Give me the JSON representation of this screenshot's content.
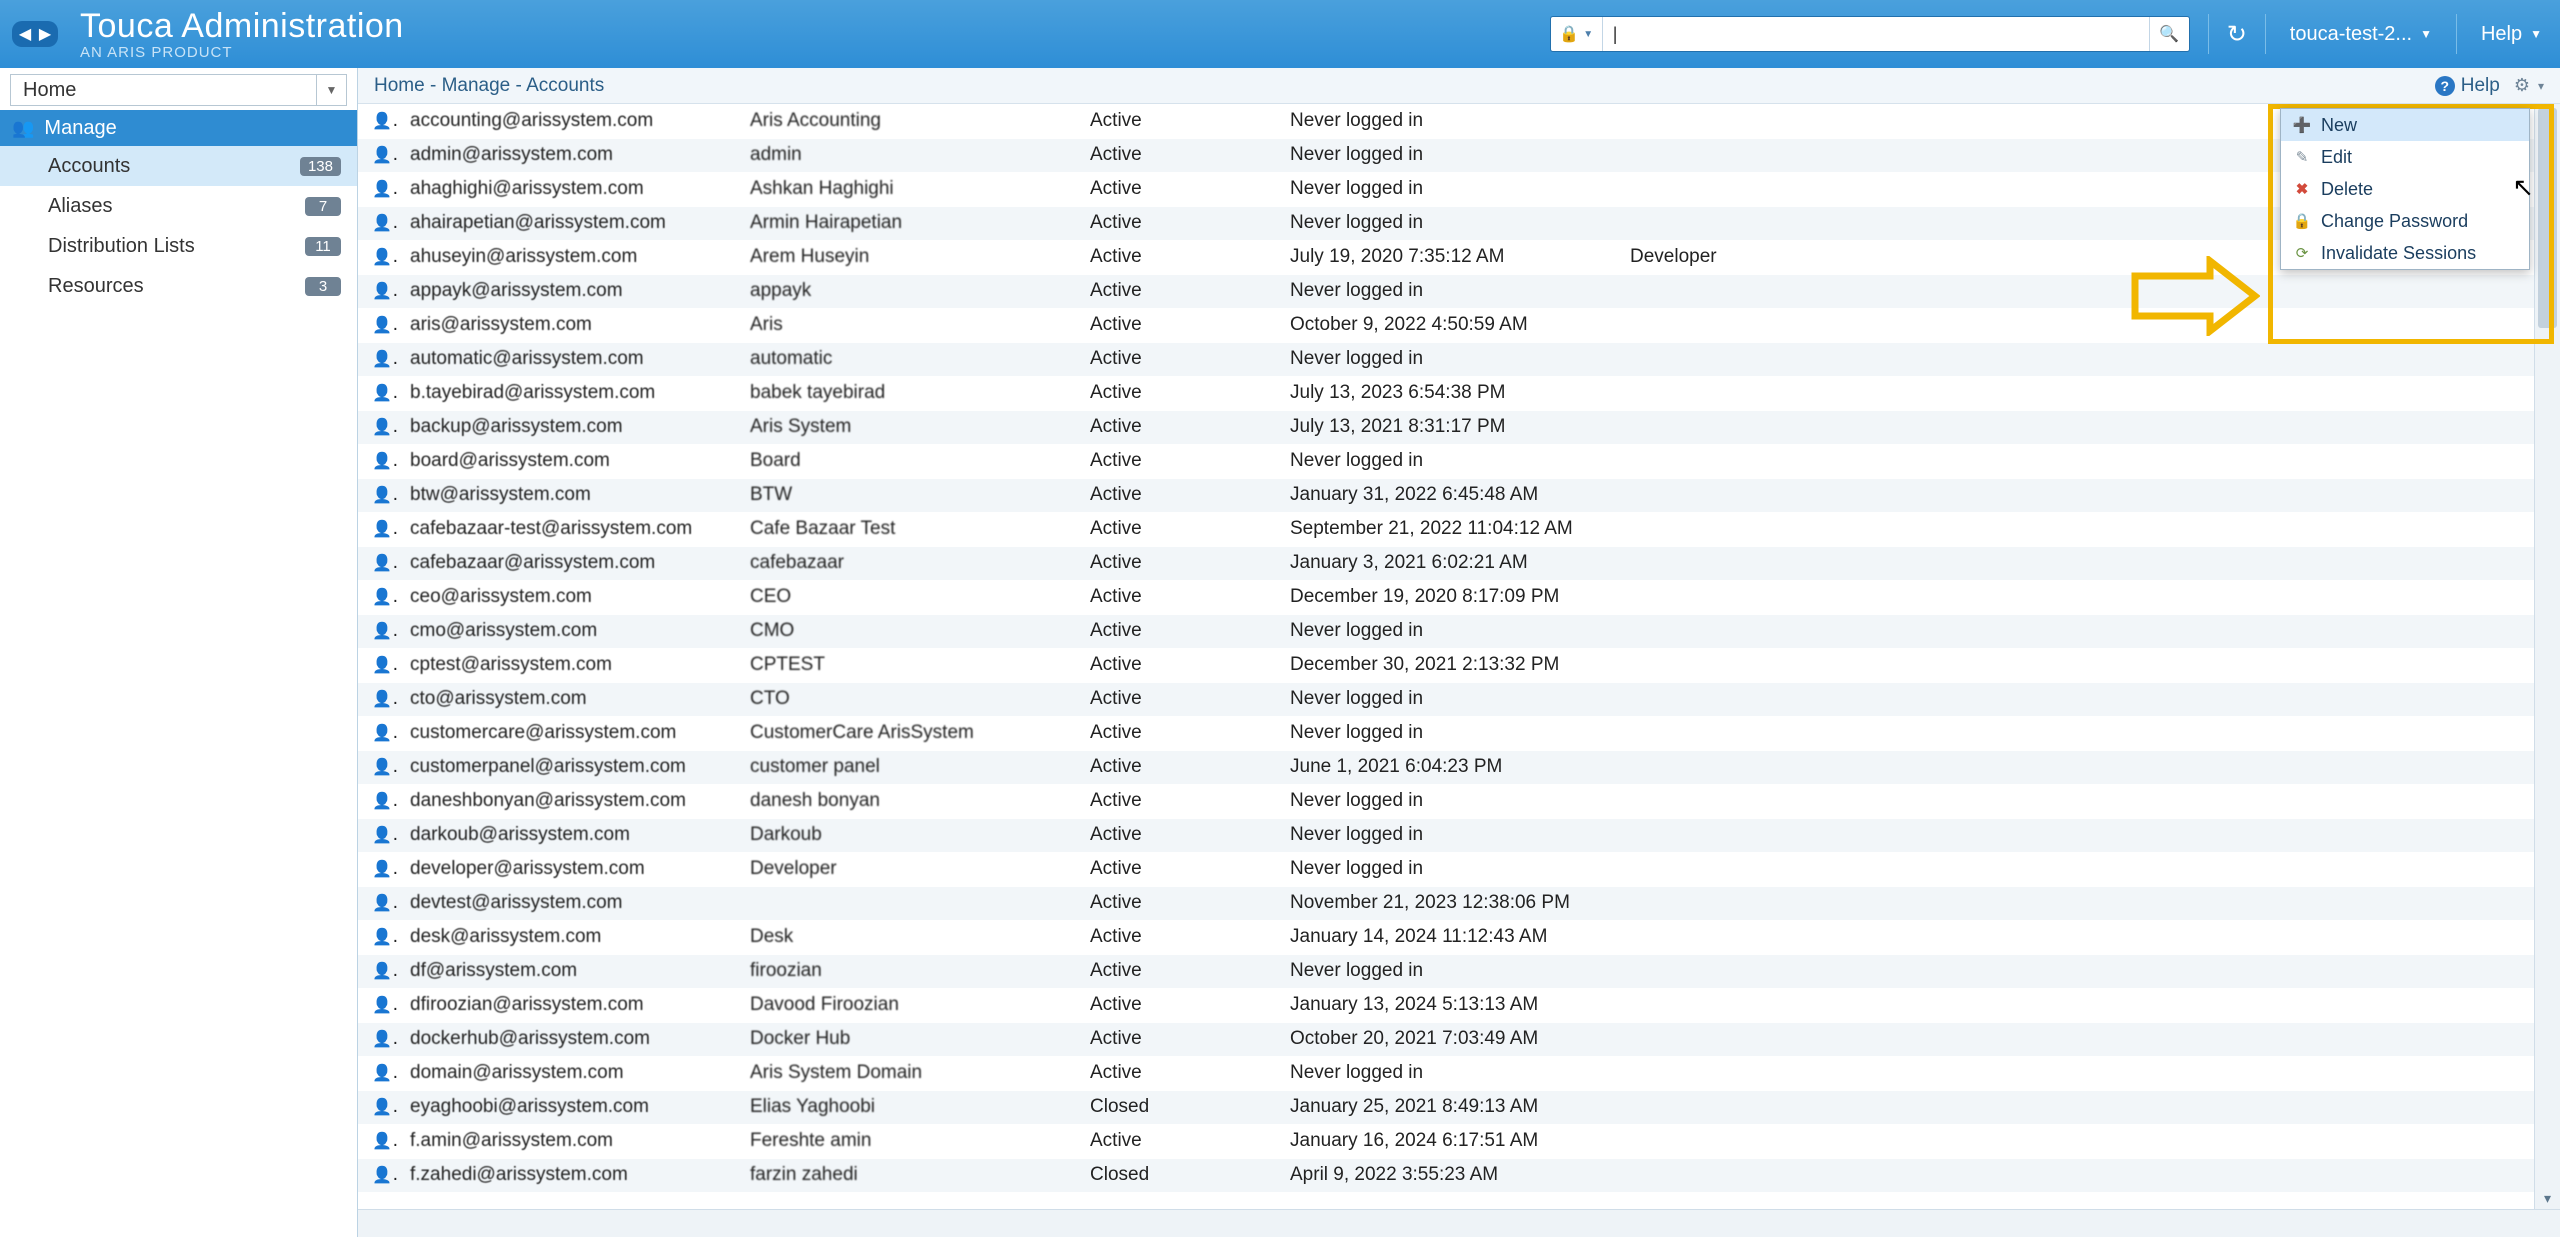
{
  "header": {
    "title": "Touca Administration",
    "subtitle": "AN ARIS PRODUCT",
    "search_placeholder": "",
    "search_value": "|",
    "user_label": "touca-test-2...",
    "help_label": "Help"
  },
  "sidebar": {
    "home_label": "Home",
    "section_label": "Manage",
    "items": [
      {
        "label": "Accounts",
        "badge": "138",
        "selected": true
      },
      {
        "label": "Aliases",
        "badge": "7",
        "selected": false
      },
      {
        "label": "Distribution Lists",
        "badge": "11",
        "selected": false
      },
      {
        "label": "Resources",
        "badge": "3",
        "selected": false
      }
    ]
  },
  "breadcrumb": {
    "parts": [
      "Home",
      "Manage",
      "Accounts"
    ],
    "help_label": "Help"
  },
  "context_menu": {
    "items": [
      {
        "key": "new",
        "label": "New",
        "hover": true
      },
      {
        "key": "edit",
        "label": "Edit",
        "hover": false
      },
      {
        "key": "delete",
        "label": "Delete",
        "hover": false
      },
      {
        "key": "change_password",
        "label": "Change Password",
        "hover": false
      },
      {
        "key": "invalidate_sessions",
        "label": "Invalidate Sessions",
        "hover": false
      }
    ]
  },
  "table": {
    "rows": [
      {
        "email": "accounting@arissystem.com",
        "name": "Aris Accounting",
        "status": "Active",
        "login": "Never logged in",
        "role": ""
      },
      {
        "email": "admin@arissystem.com",
        "name": "admin",
        "status": "Active",
        "login": "Never logged in",
        "role": ""
      },
      {
        "email": "ahaghighi@arissystem.com",
        "name": "Ashkan Haghighi",
        "status": "Active",
        "login": "Never logged in",
        "role": ""
      },
      {
        "email": "ahairapetian@arissystem.com",
        "name": "Armin Hairapetian",
        "status": "Active",
        "login": "Never logged in",
        "role": ""
      },
      {
        "email": "ahuseyin@arissystem.com",
        "name": "Arem Huseyin",
        "status": "Active",
        "login": "July 19, 2020 7:35:12 AM",
        "role": "Developer"
      },
      {
        "email": "appayk@arissystem.com",
        "name": "appayk",
        "status": "Active",
        "login": "Never logged in",
        "role": ""
      },
      {
        "email": "aris@arissystem.com",
        "name": "Aris",
        "status": "Active",
        "login": "October 9, 2022 4:50:59 AM",
        "role": ""
      },
      {
        "email": "automatic@arissystem.com",
        "name": "automatic",
        "status": "Active",
        "login": "Never logged in",
        "role": ""
      },
      {
        "email": "b.tayebirad@arissystem.com",
        "name": "babek tayebirad",
        "status": "Active",
        "login": "July 13, 2023 6:54:38 PM",
        "role": ""
      },
      {
        "email": "backup@arissystem.com",
        "name": "Aris System",
        "status": "Active",
        "login": "July 13, 2021 8:31:17 PM",
        "role": ""
      },
      {
        "email": "board@arissystem.com",
        "name": "Board",
        "status": "Active",
        "login": "Never logged in",
        "role": ""
      },
      {
        "email": "btw@arissystem.com",
        "name": "BTW",
        "status": "Active",
        "login": "January 31, 2022 6:45:48 AM",
        "role": ""
      },
      {
        "email": "cafebazaar-test@arissystem.com",
        "name": "Cafe Bazaar Test",
        "status": "Active",
        "login": "September 21, 2022 11:04:12 AM",
        "role": ""
      },
      {
        "email": "cafebazaar@arissystem.com",
        "name": "cafebazaar",
        "status": "Active",
        "login": "January 3, 2021 6:02:21 AM",
        "role": ""
      },
      {
        "email": "ceo@arissystem.com",
        "name": "CEO",
        "status": "Active",
        "login": "December 19, 2020 8:17:09 PM",
        "role": ""
      },
      {
        "email": "cmo@arissystem.com",
        "name": "CMO",
        "status": "Active",
        "login": "Never logged in",
        "role": ""
      },
      {
        "email": "cptest@arissystem.com",
        "name": "CPTEST",
        "status": "Active",
        "login": "December 30, 2021 2:13:32 PM",
        "role": ""
      },
      {
        "email": "cto@arissystem.com",
        "name": "CTO",
        "status": "Active",
        "login": "Never logged in",
        "role": ""
      },
      {
        "email": "customercare@arissystem.com",
        "name": "CustomerCare ArisSystem",
        "status": "Active",
        "login": "Never logged in",
        "role": ""
      },
      {
        "email": "customerpanel@arissystem.com",
        "name": "customer panel",
        "status": "Active",
        "login": "June 1, 2021 6:04:23 PM",
        "role": ""
      },
      {
        "email": "daneshbonyan@arissystem.com",
        "name": "danesh bonyan",
        "status": "Active",
        "login": "Never logged in",
        "role": ""
      },
      {
        "email": "darkoub@arissystem.com",
        "name": "Darkoub",
        "status": "Active",
        "login": "Never logged in",
        "role": ""
      },
      {
        "email": "developer@arissystem.com",
        "name": "Developer",
        "status": "Active",
        "login": "Never logged in",
        "role": ""
      },
      {
        "email": "devtest@arissystem.com",
        "name": "",
        "status": "Active",
        "login": "November 21, 2023 12:38:06 PM",
        "role": ""
      },
      {
        "email": "desk@arissystem.com",
        "name": "Desk",
        "status": "Active",
        "login": "January 14, 2024 11:12:43 AM",
        "role": ""
      },
      {
        "email": "df@arissystem.com",
        "name": "firoozian",
        "status": "Active",
        "login": "Never logged in",
        "role": ""
      },
      {
        "email": "dfiroozian@arissystem.com",
        "name": "Davood Firoozian",
        "status": "Active",
        "login": "January 13, 2024 5:13:13 AM",
        "role": ""
      },
      {
        "email": "dockerhub@arissystem.com",
        "name": "Docker Hub",
        "status": "Active",
        "login": "October 20, 2021 7:03:49 AM",
        "role": ""
      },
      {
        "email": "domain@arissystem.com",
        "name": "Aris System Domain",
        "status": "Active",
        "login": "Never logged in",
        "role": ""
      },
      {
        "email": "eyaghoobi@arissystem.com",
        "name": "Elias Yaghoobi",
        "status": "Closed",
        "login": "January 25, 2021 8:49:13 AM",
        "role": ""
      },
      {
        "email": "f.amin@arissystem.com",
        "name": "Fereshte amin",
        "status": "Active",
        "login": "January 16, 2024 6:17:51 AM",
        "role": ""
      },
      {
        "email": "f.zahedi@arissystem.com",
        "name": "farzin zahedi",
        "status": "Closed",
        "login": "April 9, 2022 3:55:23 AM",
        "role": ""
      }
    ]
  }
}
